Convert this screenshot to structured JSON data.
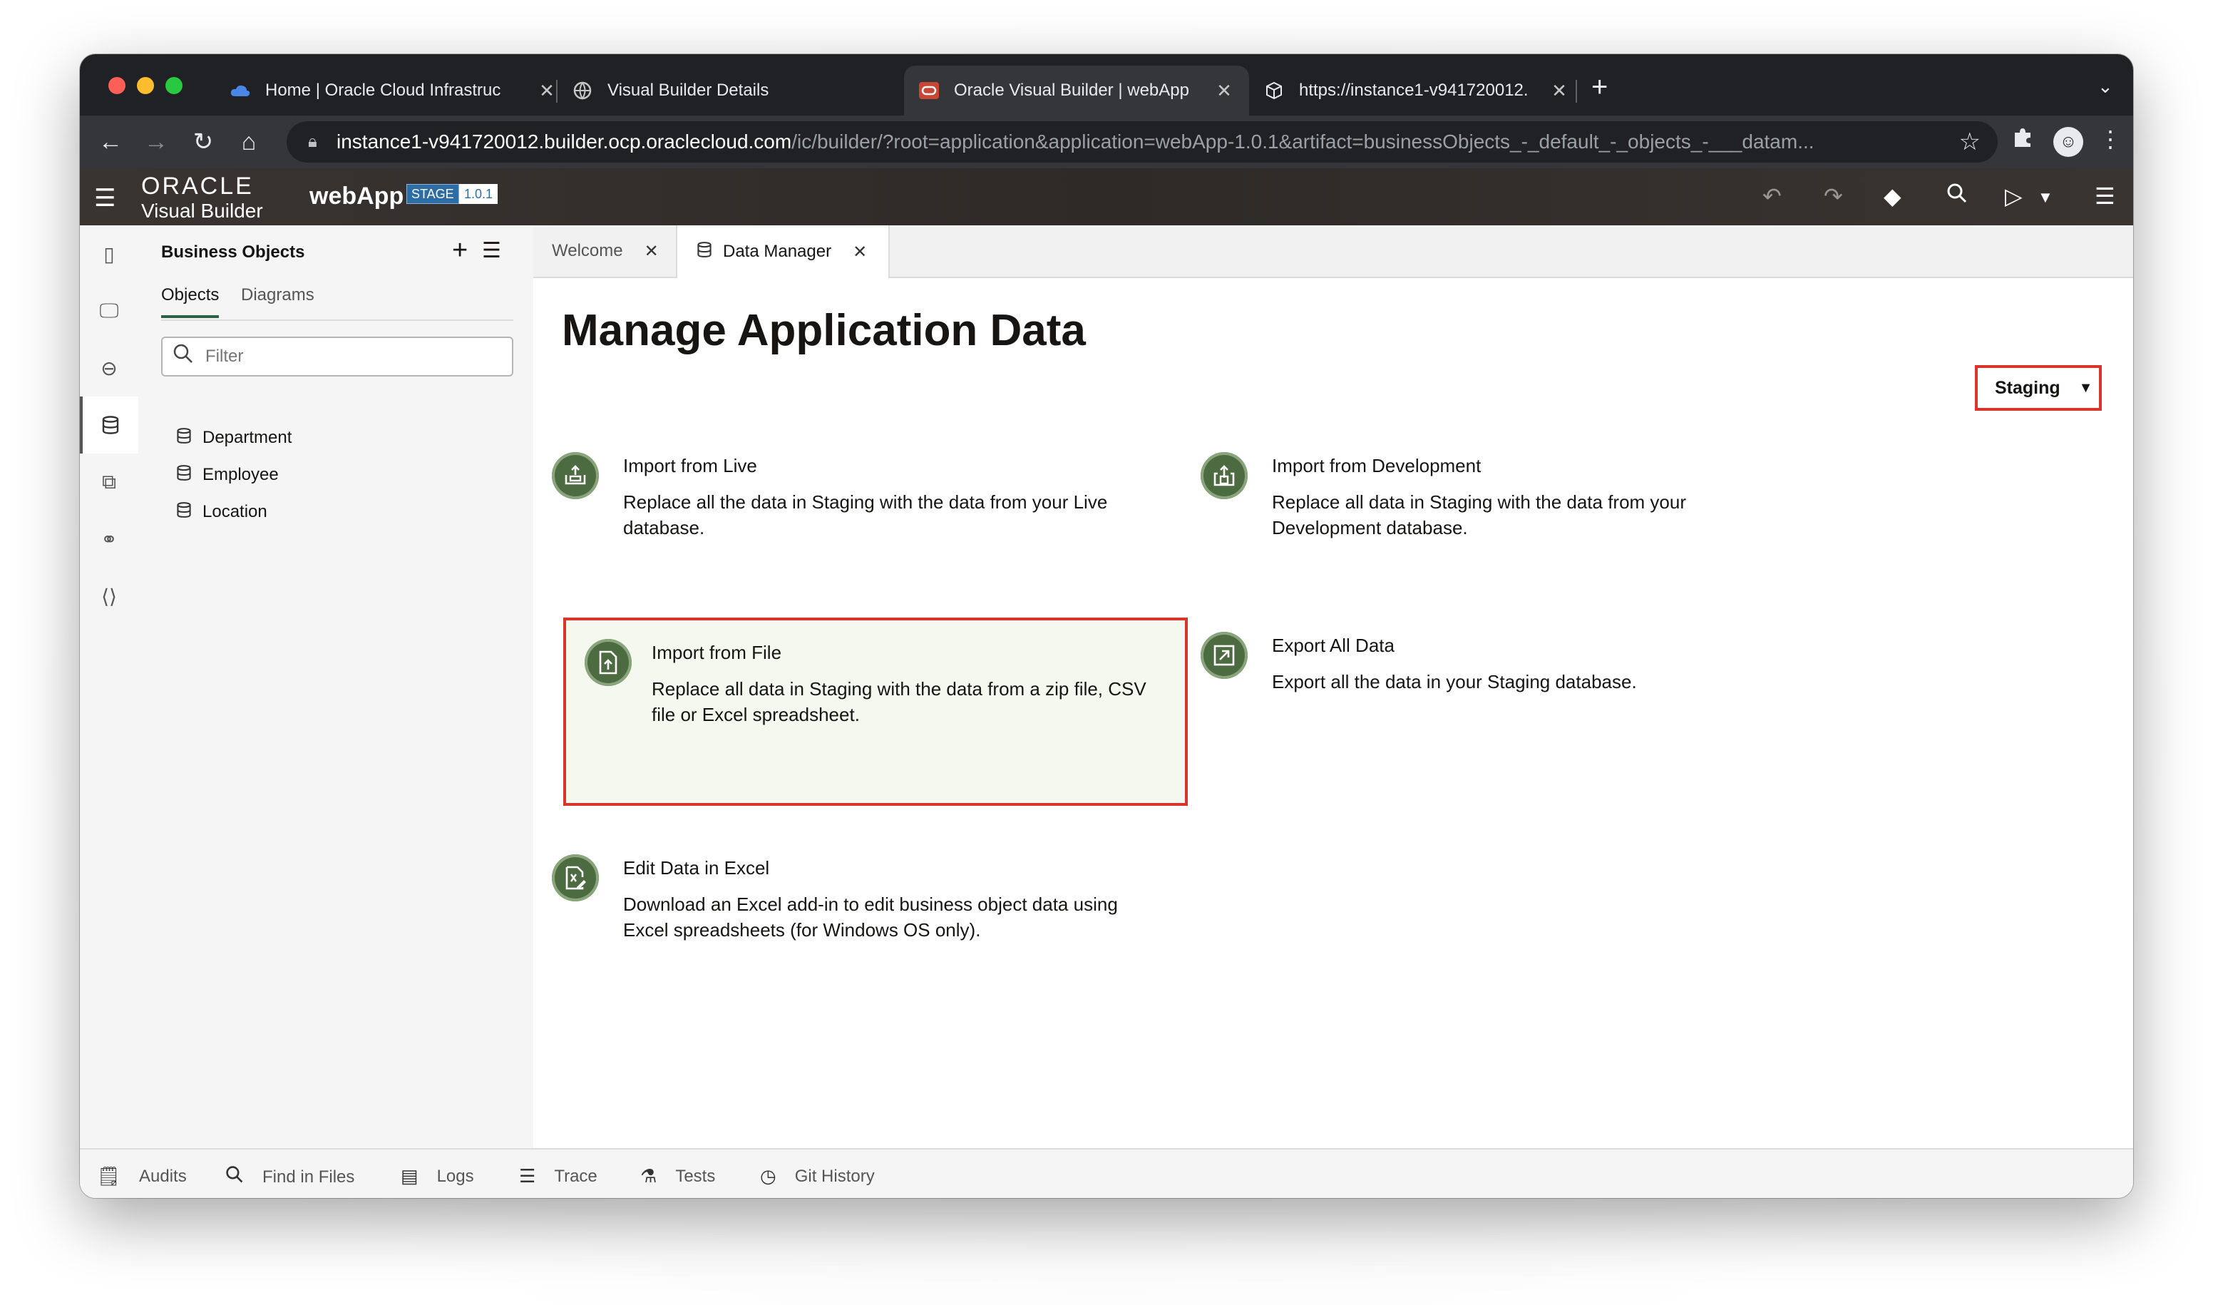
{
  "browser": {
    "tabs": [
      {
        "label": "Home | Oracle Cloud Infrastruc",
        "icon": "cloud-icon"
      },
      {
        "label": "Visual Builder Details",
        "icon": "globe-icon"
      },
      {
        "label": "Oracle Visual Builder | webApp",
        "icon": "oracle-icon"
      },
      {
        "label": "https://instance1-v941720012.",
        "icon": "cube-icon"
      }
    ],
    "url_host": "instance1-v941720012.builder.ocp.oraclecloud.com",
    "url_path": "/ic/builder/?root=application&application=webApp-1.0.1&artifact=businessObjects_-_default_-_objects_-___datam..."
  },
  "header": {
    "brand_top": "ORACLE",
    "brand_bottom": "Visual Builder",
    "app_name": "webApp",
    "stage_badge": "STAGE",
    "version_badge": "1.0.1"
  },
  "nav_panel": {
    "title": "Business Objects",
    "tabs": [
      "Objects",
      "Diagrams"
    ],
    "filter_placeholder": "Filter",
    "items": [
      "Department",
      "Employee",
      "Location"
    ]
  },
  "editor_tabs": [
    {
      "label": "Welcome"
    },
    {
      "label": "Data Manager"
    }
  ],
  "main": {
    "title": "Manage Application Data",
    "environment": "Staging",
    "cards": [
      {
        "title": "Import from Live",
        "description": "Replace all the data in Staging with the data from your Live database."
      },
      {
        "title": "Import from Development",
        "description": "Replace all data in Staging with the data from your Development database."
      },
      {
        "title": "Import from File",
        "description": "Replace all data in Staging with the data from a zip file, CSV file or Excel spreadsheet."
      },
      {
        "title": "Export All Data",
        "description": "Export all the data in your Staging database."
      },
      {
        "title": "Edit Data in Excel",
        "description": "Download an Excel add-in to edit business object data using Excel spreadsheets (for Windows OS only)."
      }
    ]
  },
  "bottom_bar": [
    "Audits",
    "Find in Files",
    "Logs",
    "Trace",
    "Tests",
    "Git History"
  ],
  "colors": {
    "highlight_border": "#d9352a",
    "card_icon_green": "#4d6b41",
    "header_bg": "#3a3431"
  }
}
